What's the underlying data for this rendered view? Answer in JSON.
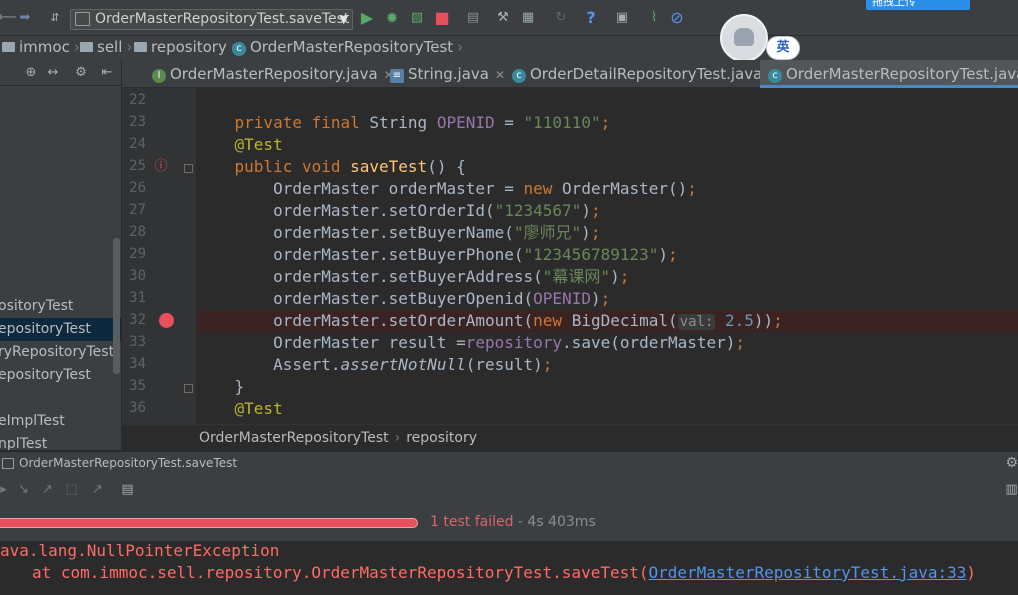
{
  "toolbar": {
    "run_config": "OrderMasterRepositoryTest.saveTest",
    "upload_label": "拖拽上传",
    "ime_label": "英",
    "icons": [
      "back-arrow-icon",
      "forward-arrow-icon",
      "sort-icon",
      "run-config-icon",
      "dropdown-icon",
      "run-icon",
      "debug-icon",
      "coverage-icon",
      "stop-icon",
      "sdk-icon",
      "settings-icon",
      "project-structure-icon",
      "sync-icon",
      "help-icon",
      "vcs-icon",
      "profiler-icon",
      "block-icon"
    ]
  },
  "breadcrumbs": [
    "immoc",
    "sell",
    "repository",
    "OrderMasterRepositoryTest"
  ],
  "sidebar": {
    "items": [
      "ositoryTest",
      "epositoryTest",
      "ryRepositoryTest",
      "epositoryTest",
      "eImplTest",
      "nplTest"
    ],
    "selected_index": 1
  },
  "tabs": [
    {
      "label": "OrderMasterRepository.java",
      "icon": "interface-icon",
      "active": false
    },
    {
      "label": "String.java",
      "icon": "class-file-icon",
      "active": false
    },
    {
      "label": "OrderDetailRepositoryTest.java",
      "icon": "class-icon",
      "active": false
    },
    {
      "label": "OrderMasterRepositoryTest.java",
      "icon": "class-icon",
      "active": true
    }
  ],
  "editor": {
    "line_numbers": [
      "22",
      "23",
      "24",
      "25",
      "26",
      "27",
      "28",
      "29",
      "30",
      "31",
      "32",
      "33",
      "34",
      "35",
      "36"
    ],
    "breakpoint_line": "32",
    "lines": {
      "l23_kw": "private final ",
      "l23_type": "String ",
      "l23_field": "OPENID",
      "l23_eq": " = ",
      "l23_str": "\"110110\"",
      "l23_end": ";",
      "l24_ann": "@Test",
      "l25_kw": "public void ",
      "l25_fn": "saveTest",
      "l25_rest": "() {",
      "l26_a": "OrderMaster orderMaster = ",
      "l26_kw": "new ",
      "l26_b": "OrderMaster()",
      "l26_end": ";",
      "l27_a": "orderMaster.setOrderId(",
      "l27_str": "\"1234567\"",
      "l27_b": ")",
      "l27_end": ";",
      "l28_a": "orderMaster.setBuyerName(",
      "l28_str": "\"廖师兄\"",
      "l28_b": ")",
      "l28_end": ";",
      "l29_a": "orderMaster.setBuyerPhone(",
      "l29_str": "\"123456789123\"",
      "l29_b": ")",
      "l29_end": ";",
      "l30_a": "orderMaster.setBuyerAddress(",
      "l30_str": "\"幕课网\"",
      "l30_b": ")",
      "l30_end": ";",
      "l31_a": "orderMaster.setBuyerOpenid(",
      "l31_field": "OPENID",
      "l31_b": ")",
      "l31_end": ";",
      "l32_a": "orderMaster.setOrderAmount(",
      "l32_kw": "new ",
      "l32_b": "BigDecimal(",
      "l32_hint": "val:",
      "l32_num": " 2.5",
      "l32_c": "))",
      "l32_end": ";",
      "l33_a": "OrderMaster result =",
      "l33_field": "repository",
      "l33_b": ".save(orderMaster)",
      "l33_end": ";",
      "l34_a": "Assert.",
      "l34_fn": "assertNotNull",
      "l34_b": "(result)",
      "l34_end": ";",
      "l35": "}",
      "l36_ann": "@Test"
    }
  },
  "editor_breadcrumbs": [
    "OrderMasterRepositoryTest",
    "repository"
  ],
  "run_panel": {
    "title": "OrderMasterRepositoryTest.saveTest",
    "progress": 1.0,
    "status": "1 test failed",
    "duration": " - 4s 403ms"
  },
  "console": {
    "line1": "ava.lang.NullPointerException",
    "line2_prefix": "at com.immoc.sell.repository.OrderMasterRepositoryTest.saveTest(",
    "line2_link": "OrderMasterRepositoryTest.java:33",
    "line2_suffix": ")"
  },
  "colors": {
    "background": "#2b2b2b",
    "panel": "#3c3f41",
    "keyword": "#cc7832",
    "string": "#6a8759",
    "field": "#9876aa",
    "annotation": "#bbb529",
    "error": "#e8505b",
    "link": "#5394ec"
  }
}
